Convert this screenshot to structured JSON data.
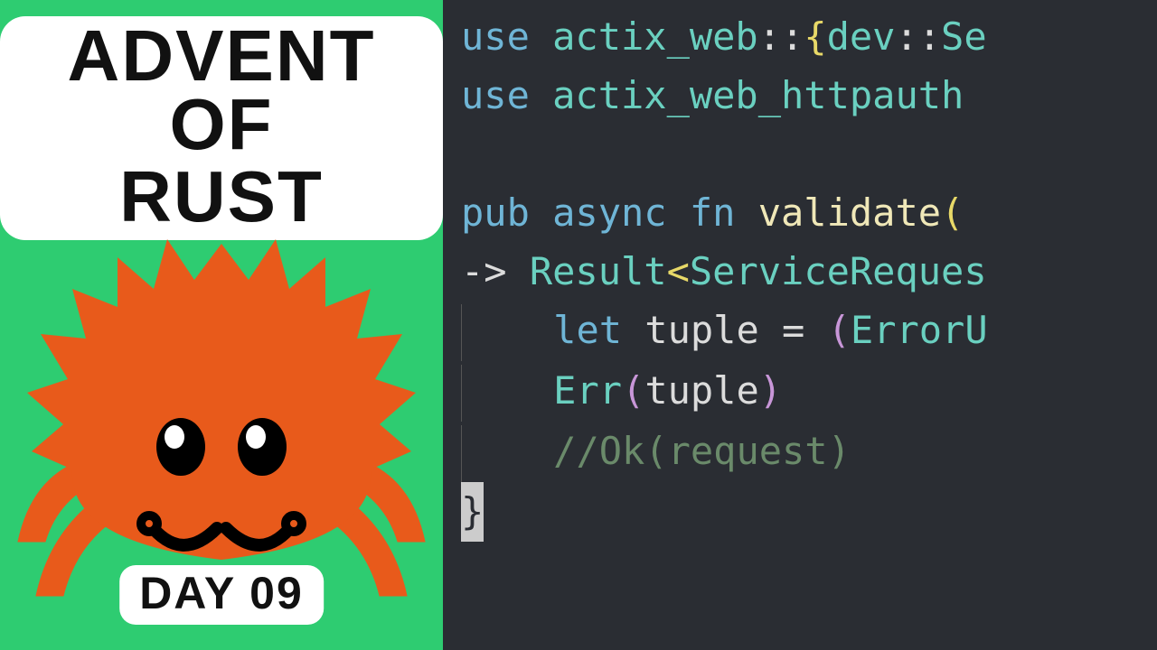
{
  "colors": {
    "left_bg": "#2ecc71",
    "right_bg": "#2a2d33",
    "crab": "#e85a1b"
  },
  "title": {
    "line1": "ADVENT OF",
    "line2": "RUST"
  },
  "day_badge": "DAY 09",
  "code": {
    "l1_use": "use",
    "l1_rest": " actix_web",
    "l1_sep": "::",
    "l1_brace": "{",
    "l1_dev": "dev",
    "l1_sep2": "::",
    "l1_tail": "Se",
    "l2_use": "use",
    "l2_rest": " actix_web_httpauth",
    "l4_pub": "pub",
    "l4_async": " async",
    "l4_fn": " fn",
    "l4_name": " validate",
    "l4_paren": "(",
    "l5_arrow": "->",
    "l5_result": " Result",
    "l5_lt": "<",
    "l5_sr": "ServiceReques",
    "l6_let": "let",
    "l6_tuple": " tuple ",
    "l6_eq": "=",
    "l6_open": " (",
    "l6_err": "ErrorU",
    "l7_err": "Err",
    "l7_p1": "(",
    "l7_tuple": "tuple",
    "l7_p2": ")",
    "l8_comment": "//Ok(request)",
    "l9_brace": "}"
  }
}
